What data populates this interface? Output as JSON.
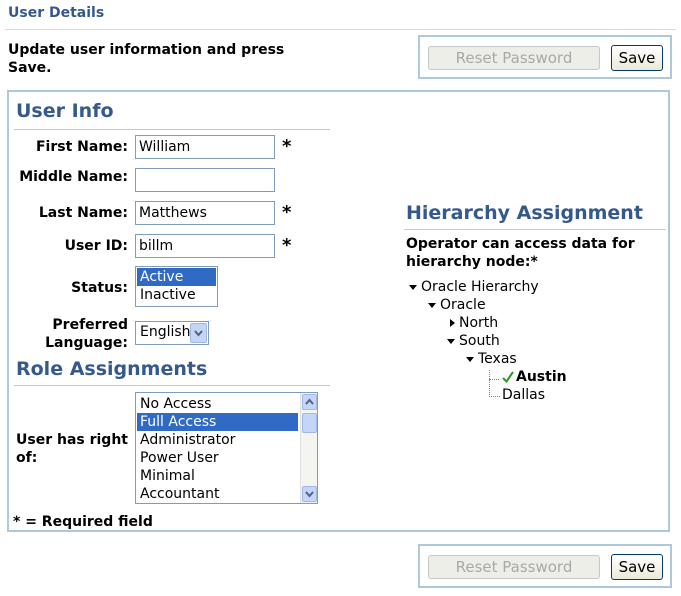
{
  "header": {
    "title": "User Details"
  },
  "intro_text": "Update user information and press Save.",
  "buttons": {
    "reset_password": "Reset Password",
    "save": "Save"
  },
  "user_info": {
    "title": "User Info",
    "first_name": {
      "label": "First Name:",
      "value": "William",
      "required": "*"
    },
    "middle_name": {
      "label": "Middle Name:",
      "value": ""
    },
    "last_name": {
      "label": "Last Name:",
      "value": "Matthews",
      "required": "*"
    },
    "user_id": {
      "label": "User ID:",
      "value": "billm",
      "required": "*"
    },
    "status": {
      "label": "Status:",
      "options": [
        "Active",
        "Inactive"
      ],
      "selected": "Active"
    },
    "language": {
      "label_line1": "Preferred",
      "label_line2": "Language:",
      "value": "English"
    }
  },
  "role_assignments": {
    "title": "Role Assignments",
    "label": "User has right of:",
    "options": [
      "No Access",
      "Full Access",
      "Administrator",
      "Power User",
      "Minimal",
      "Accountant"
    ],
    "selected": "Full Access"
  },
  "required_note": "* = Required field",
  "hierarchy": {
    "title": "Hierarchy Assignment",
    "desc": "Operator can access data for hierarchy node:*",
    "nodes": {
      "root": "Oracle Hierarchy",
      "oracle": "Oracle",
      "north": "North",
      "south": "South",
      "texas": "Texas",
      "austin": "Austin",
      "dallas": "Dallas"
    },
    "selected_node": "Austin"
  },
  "colors": {
    "accent": "#36598c",
    "border": "#b0c8dc",
    "selection": "#316ac5"
  }
}
